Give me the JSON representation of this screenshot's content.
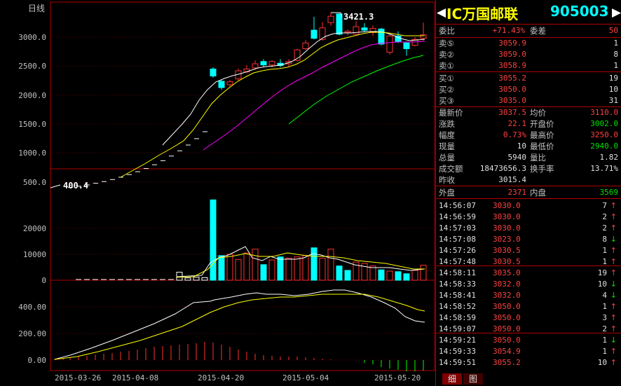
{
  "chart": {
    "period_label": "日线",
    "high_mark": "3421.3",
    "low_mark": "400.4",
    "price_axis": [
      "3000.0",
      "2500.0",
      "2000.0",
      "1500.0",
      "1000.0",
      "500.0"
    ],
    "volume_axis": [
      "20000",
      "10000",
      "0"
    ],
    "indicator_axis": [
      "400.00",
      "200.00",
      "0.00"
    ],
    "dates": [
      "2015-03-26",
      "2015-04-08",
      "2015-04-20",
      "2015-05-04",
      "2015-05-20"
    ]
  },
  "chart_data": {
    "type": "candlestick",
    "price_ylim": [
      400,
      3421.3
    ],
    "volume_ylim": [
      0,
      30000
    ],
    "indicator_ylim": [
      0,
      500
    ],
    "dates_shown": [
      "2015-03-26",
      "2015-04-08",
      "2015-04-20",
      "2015-05-04",
      "2015-05-20"
    ],
    "colors": {
      "up": "#ff3030",
      "down": "#00ffff",
      "ma5": "#ffffff",
      "ma10": "#ffff00",
      "ma20": "#ff00ff",
      "ma60": "#00ff00"
    }
  },
  "header": {
    "left_arrow": "◀",
    "name": "IC万国邮联",
    "code": "905003",
    "right_arrow": "▶"
  },
  "quote": {
    "weibi_label": "委比",
    "weibi_value": "+71.43%",
    "weicha_label": "委差",
    "weicha_value": "50",
    "sells": [
      {
        "label": "卖⑤",
        "price": "3059.9",
        "vol": "1"
      },
      {
        "label": "卖②",
        "price": "3059.0",
        "vol": "8"
      },
      {
        "label": "卖①",
        "price": "3058.9",
        "vol": "1"
      }
    ],
    "buys": [
      {
        "label": "买①",
        "price": "3055.2",
        "vol": "19"
      },
      {
        "label": "买②",
        "price": "3050.0",
        "vol": "10"
      },
      {
        "label": "买③",
        "price": "3035.0",
        "vol": "31"
      }
    ],
    "stats": [
      {
        "l1": "最新价",
        "v1": "3037.5",
        "l2": "均价",
        "v2": "3110.0"
      },
      {
        "l1": "涨跌",
        "v1": "22.1",
        "l2": "开盘价",
        "v2": "3002.0"
      },
      {
        "l1": "幅度",
        "v1": "0.73%",
        "l2": "最高价",
        "v2": "3250.0"
      },
      {
        "l1": "现量",
        "v1": "10",
        "l2": "最低价",
        "v2": "2940.0"
      },
      {
        "l1": "总量",
        "v1": "5940",
        "l2": "量比",
        "v2": "1.82"
      },
      {
        "l1": "成交额",
        "v1": "18473656.3",
        "l2": "换手率",
        "v2": "13.71%"
      }
    ],
    "prev_close_label": "昨收",
    "prev_close_value": "3015.4",
    "outer_label": "外盘",
    "outer_value": "2371",
    "inner_label": "内盘",
    "inner_value": "3569"
  },
  "ticks": [
    {
      "time": "14:56:07",
      "price": "3030.0",
      "vol": "7",
      "dir": "↑"
    },
    {
      "time": "14:56:59",
      "price": "3030.0",
      "vol": "2",
      "dir": "↑"
    },
    {
      "time": "14:57:03",
      "price": "3030.0",
      "vol": "2",
      "dir": "↑"
    },
    {
      "time": "14:57:08",
      "price": "3023.0",
      "vol": "8",
      "dir": "↓"
    },
    {
      "time": "14:57:26",
      "price": "3030.5",
      "vol": "1",
      "dir": "↑"
    },
    {
      "time": "14:57:48",
      "price": "3030.5",
      "vol": "1",
      "dir": "↑"
    },
    {
      "time": "14:58:11",
      "price": "3035.0",
      "vol": "19",
      "dir": "↑"
    },
    {
      "time": "14:58:33",
      "price": "3032.0",
      "vol": "10",
      "dir": "↓"
    },
    {
      "time": "14:58:41",
      "price": "3032.0",
      "vol": "4",
      "dir": "↓"
    },
    {
      "time": "14:58:52",
      "price": "3050.0",
      "vol": "1",
      "dir": "↑"
    },
    {
      "time": "14:58:59",
      "price": "3050.0",
      "vol": "3",
      "dir": "↑"
    },
    {
      "time": "14:59:07",
      "price": "3050.0",
      "vol": "2",
      "dir": "↑"
    },
    {
      "time": "14:59:21",
      "price": "3050.0",
      "vol": "1",
      "dir": "↓"
    },
    {
      "time": "14:59:33",
      "price": "3054.9",
      "vol": "1",
      "dir": "↑"
    },
    {
      "time": "14:59:51",
      "price": "3055.2",
      "vol": "10",
      "dir": "↑"
    }
  ],
  "tabs": {
    "detail": "细",
    "chart": "图"
  }
}
